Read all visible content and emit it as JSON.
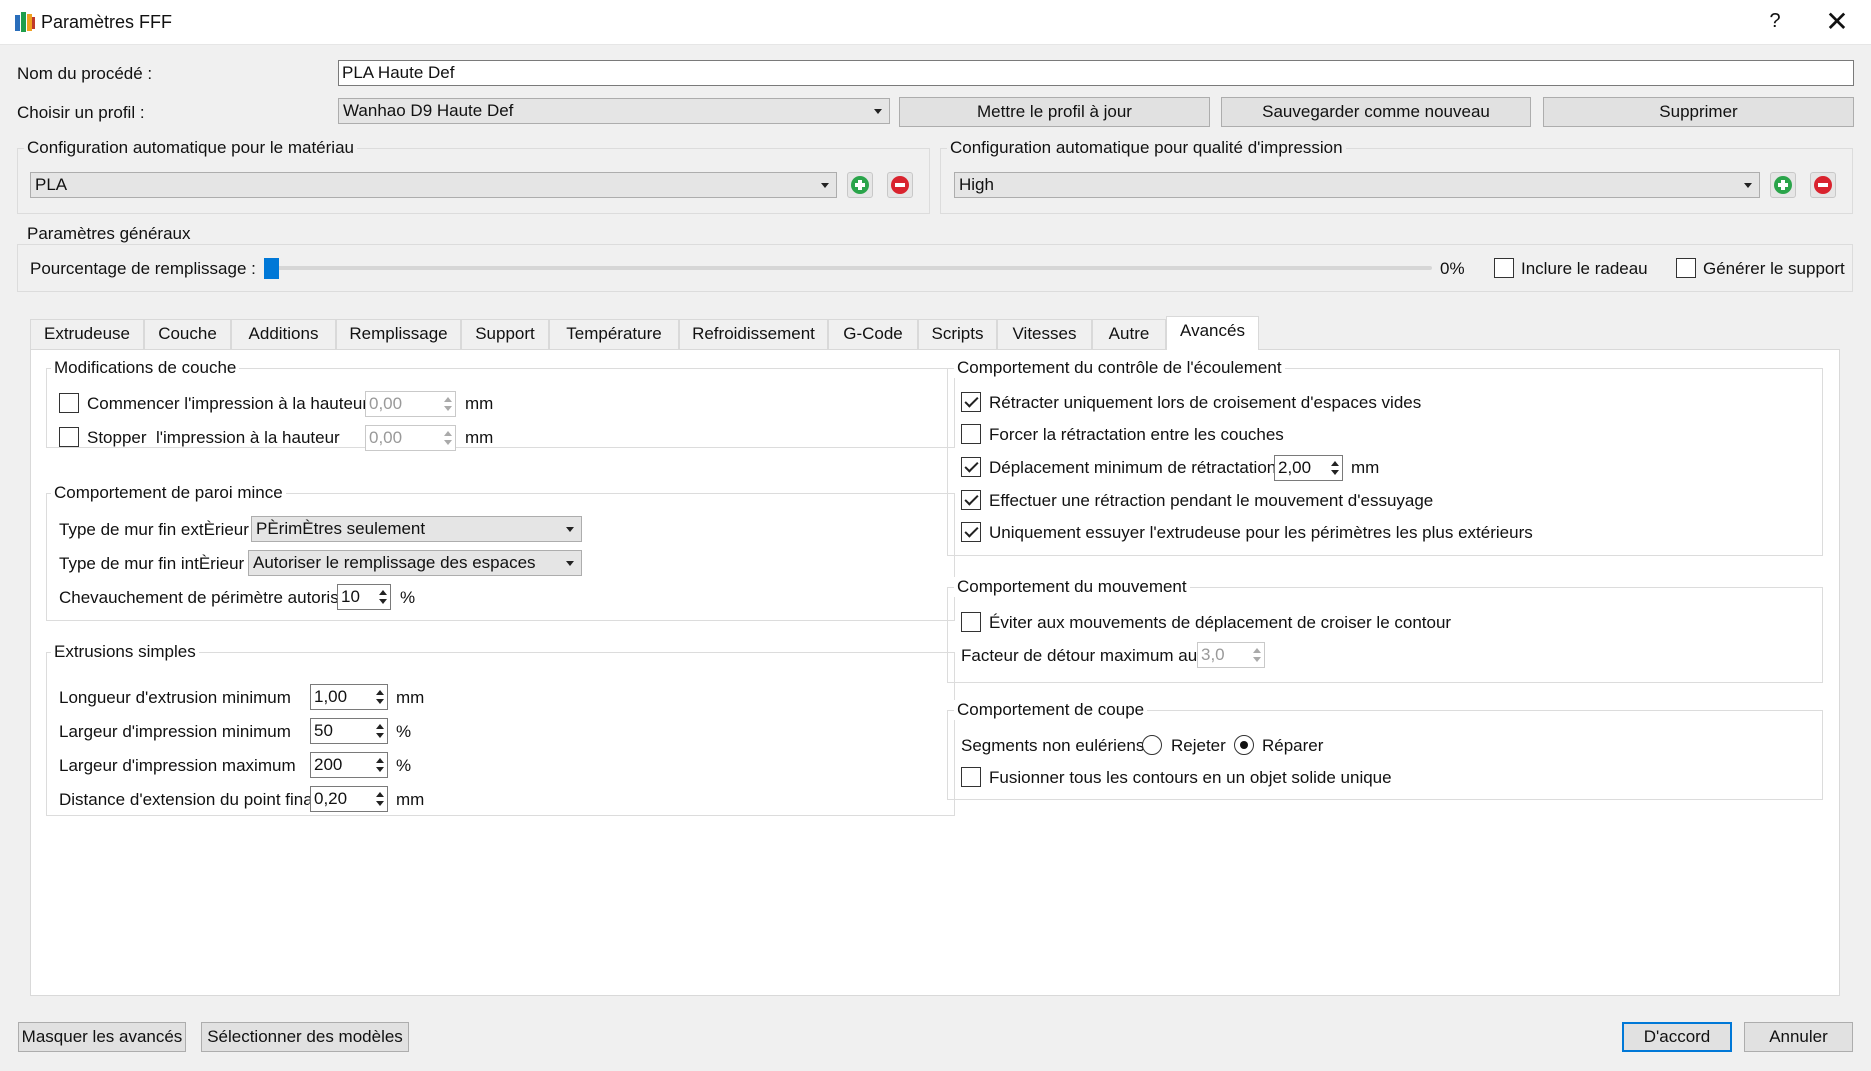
{
  "window": {
    "title": "Paramètres FFF",
    "help": "?",
    "close": "✕"
  },
  "colors": {
    "accent": "#0078d7",
    "add": "#2aa44a",
    "remove": "#d9232e"
  },
  "header": {
    "process_name_label": "Nom du procédé :",
    "process_name_value": "PLA Haute Def",
    "profile_label": "Choisir un profil :",
    "profile_value": "Wanhao D9 Haute Def",
    "update_button": "Mettre le profil à jour",
    "save_new_button": "Sauvegarder comme nouveau",
    "delete_button": "Supprimer"
  },
  "auto_material": {
    "title": "Configuration automatique pour le matériau",
    "value": "PLA"
  },
  "auto_quality": {
    "title": "Configuration automatique pour qualité d'impression",
    "value": "High"
  },
  "general": {
    "title": "Paramètres généraux",
    "infill_label": "Pourcentage de remplissage :",
    "infill_percent": 0,
    "infill_value": "0%",
    "raft_label": "Inclure le radeau",
    "raft_checked": false,
    "support_label": "Générer le support",
    "support_checked": false
  },
  "tabs": [
    {
      "label": "Extrudeuse"
    },
    {
      "label": "Couche"
    },
    {
      "label": "Additions"
    },
    {
      "label": "Remplissage"
    },
    {
      "label": "Support"
    },
    {
      "label": "Température"
    },
    {
      "label": "Refroidissement"
    },
    {
      "label": "G-Code"
    },
    {
      "label": "Scripts"
    },
    {
      "label": "Vitesses"
    },
    {
      "label": "Autre"
    },
    {
      "label": "Avancés",
      "active": true
    }
  ],
  "layer_mods": {
    "title": "Modifications de couche",
    "start_label": "Commencer l'impression à la hauteur",
    "start_value": "0,00",
    "start_unit": "mm",
    "start_checked": false,
    "stop_label": "Stopper  l'impression à la hauteur",
    "stop_value": "0,00",
    "stop_unit": "mm",
    "stop_checked": false
  },
  "thin_wall": {
    "title": "Comportement de paroi mince",
    "outer_label": "Type de mur fin extÈrieur",
    "outer_value": "PÈrimÈtres seulement",
    "inner_label": "Type de mur fin intÈrieur",
    "inner_value": "Autoriser le remplissage des espaces",
    "overlap_label": "Chevauchement de périmètre autorisé",
    "overlap_value": "10",
    "overlap_unit": "%"
  },
  "single_extrusions": {
    "title": "Extrusions simples",
    "rows": [
      {
        "label": "Longueur d'extrusion minimum",
        "value": "1,00",
        "unit": "mm"
      },
      {
        "label": "Largeur d'impression minimum",
        "value": "50",
        "unit": "%"
      },
      {
        "label": "Largeur d'impression maximum",
        "value": "200",
        "unit": "%"
      },
      {
        "label": "Distance d'extension du point final",
        "value": "0,20",
        "unit": "mm"
      }
    ]
  },
  "ooze": {
    "title": "Comportement du contrôle de l'écoulement",
    "retract_crossing": "Rétracter uniquement lors de croisement d'espaces vides",
    "force_retract": "Forcer la rétractation entre les couches",
    "min_travel": "Déplacement minimum de rétractation",
    "min_travel_value": "2,00",
    "min_travel_unit": "mm",
    "wipe_retract": "Effectuer une rétraction pendant le mouvement d'essuyage",
    "wipe_outer": "Uniquement essuyer l'extrudeuse pour les périmètres les plus extérieurs"
  },
  "movement": {
    "title": "Comportement du mouvement",
    "avoid_label": "Éviter aux mouvements de déplacement de croiser le contour",
    "detour_label": "Facteur de détour maximum autorisé",
    "detour_value": "3,0"
  },
  "slicing": {
    "title": "Comportement de coupe",
    "non_euler_label": "Segments non eulériens :",
    "reject_label": "Rejeter",
    "repair_label": "Réparer",
    "merge_label": "Fusionner tous les contours en un objet solide unique"
  },
  "footer": {
    "hide_advanced": "Masquer les avancés",
    "select_models": "Sélectionner des modèles",
    "ok": "D'accord",
    "cancel": "Annuler"
  }
}
